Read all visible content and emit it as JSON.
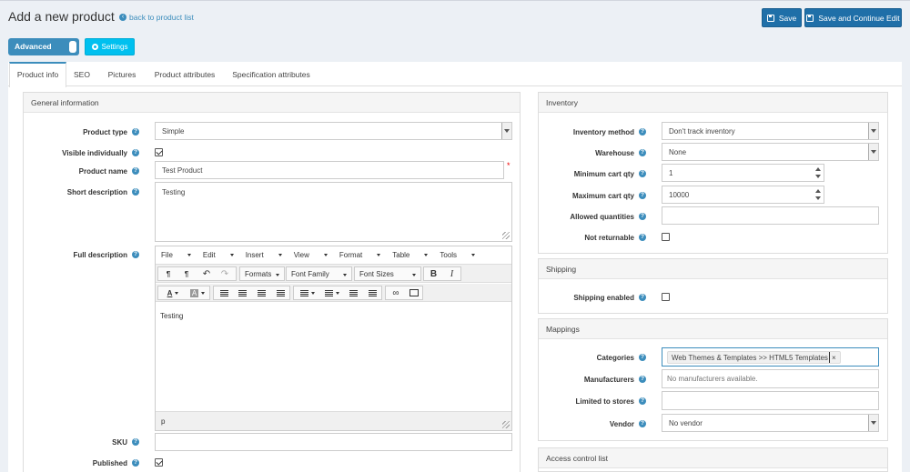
{
  "header": {
    "title": "Add a new product",
    "back_link": "back to product list",
    "save_label": "Save",
    "save_continue_label": "Save and Continue Edit",
    "advanced_label": "Advanced",
    "settings_label": "Settings"
  },
  "tabs": [
    {
      "label": "Product info",
      "active": true
    },
    {
      "label": "SEO",
      "active": false
    },
    {
      "label": "Pictures",
      "active": false
    },
    {
      "label": "Product attributes",
      "active": false
    },
    {
      "label": "Specification attributes",
      "active": false
    }
  ],
  "general": {
    "title": "General information",
    "product_type_label": "Product type",
    "product_type_value": "Simple",
    "visible_label": "Visible individually",
    "visible_checked": true,
    "name_label": "Product name",
    "name_value": "Test Product",
    "short_desc_label": "Short description",
    "short_desc_value": "Testing",
    "full_desc_label": "Full description",
    "sku_label": "SKU",
    "sku_value": "",
    "published_label": "Published",
    "published_checked": true
  },
  "editor": {
    "menu": [
      "File",
      "Edit",
      "Insert",
      "View",
      "Format",
      "Table",
      "Tools"
    ],
    "formats_label": "Formats",
    "font_family_label": "Font Family",
    "font_sizes_label": "Font Sizes",
    "bold": "B",
    "italic": "I",
    "font_color": "A",
    "bg_color": "A",
    "body_text": "Testing",
    "status_path": "p"
  },
  "inventory": {
    "title": "Inventory",
    "method_label": "Inventory method",
    "method_value": "Don't track inventory",
    "warehouse_label": "Warehouse",
    "warehouse_value": "None",
    "min_qty_label": "Minimum cart qty",
    "min_qty_value": "1",
    "max_qty_label": "Maximum cart qty",
    "max_qty_value": "10000",
    "allowed_label": "Allowed quantities",
    "allowed_value": "",
    "not_returnable_label": "Not returnable",
    "not_returnable_checked": false
  },
  "shipping": {
    "title": "Shipping",
    "enabled_label": "Shipping enabled",
    "enabled_checked": false
  },
  "mappings": {
    "title": "Mappings",
    "categories_label": "Categories",
    "category_tag": "Web Themes & Templates >> HTML5 Templates",
    "tag_remove": "×",
    "manufacturers_label": "Manufacturers",
    "manufacturers_placeholder": "No manufacturers available.",
    "stores_label": "Limited to stores",
    "vendor_label": "Vendor",
    "vendor_value": "No vendor"
  },
  "acl": {
    "title": "Access control list"
  },
  "help_glyph": "?",
  "required_glyph": "*",
  "colors": {
    "primary": "#1f6fa8",
    "accent": "#3c8dbc",
    "info": "#00c0ef",
    "panel_head": "#f5f5f5",
    "background": "#ecf0f5"
  }
}
